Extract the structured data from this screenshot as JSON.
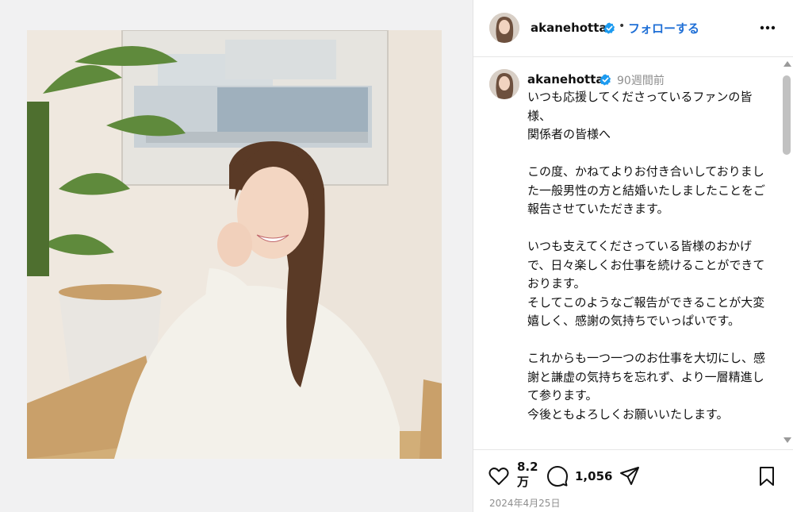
{
  "header": {
    "username": "akanehotta",
    "separator": "•",
    "follow_label": "フォローする"
  },
  "comment": {
    "username": "akanehotta",
    "time_ago": "90週間前",
    "caption": "いつも応援してくださっているファンの皆様、\n関係者の皆様へ\n\nこの度、かねてよりお付き合いしておりました一般男性の方と結婚いたしましたことをご報告させていただきます。\n\nいつも支えてくださっている皆様のおかげで、日々楽しくお仕事を続けることができております。\nそしてこのようなご報告ができることが大変嬉しく、感謝の気持ちでいっぱいです。\n\nこれからも一つ一つのお仕事を大切にし、感謝と謙虚の気持ちを忘れず、より一層精進して参ります。\n今後ともよろしくお願いいたします。"
  },
  "actions": {
    "likes": "8.2万",
    "comments": "1,056",
    "date": "2024年4月25日"
  },
  "icons": {
    "verified": "verified-badge-icon",
    "more": "more-options-icon",
    "like": "heart-icon",
    "comment": "comment-icon",
    "share": "share-icon",
    "save": "bookmark-icon"
  },
  "colors": {
    "follow": "#1f6fd6",
    "verified": "#1d9bf0",
    "muted": "#8e8e8e"
  }
}
